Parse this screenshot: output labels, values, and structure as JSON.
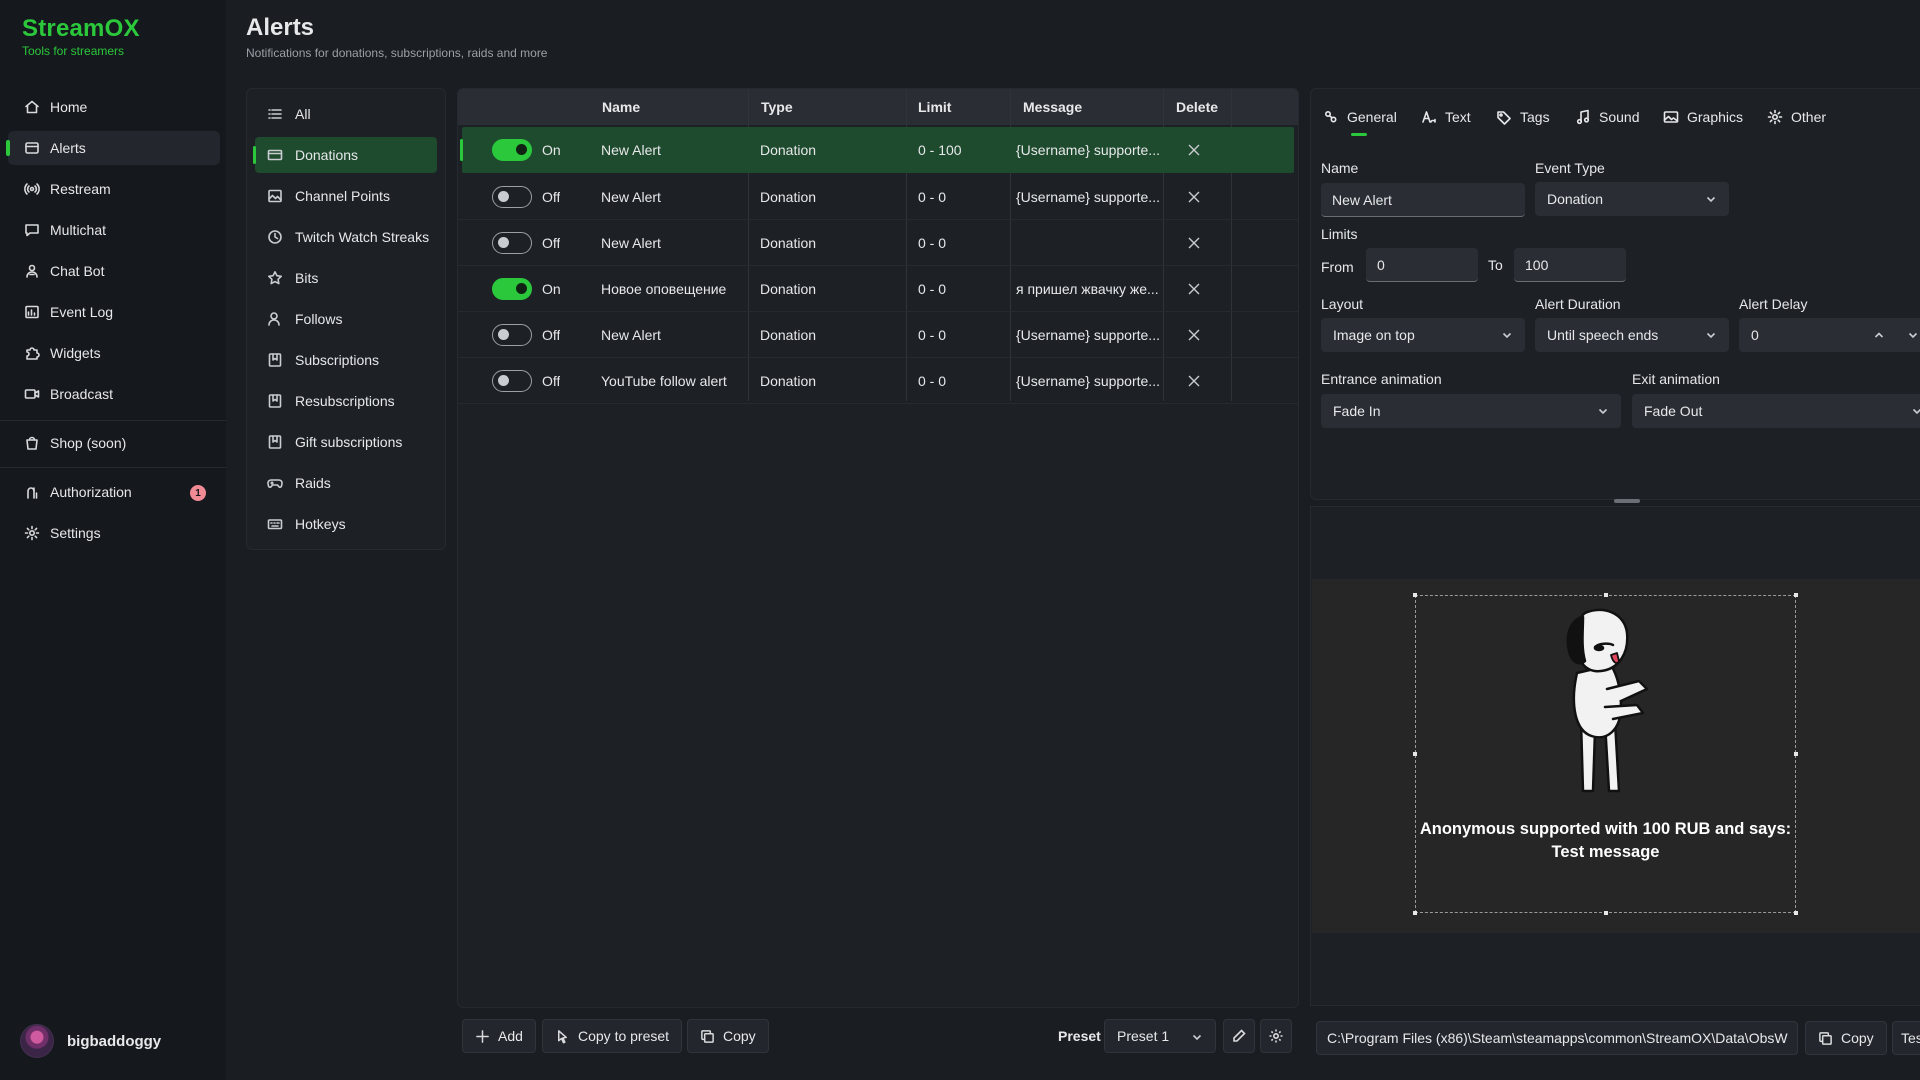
{
  "app": {
    "name": "StreamOX",
    "tagline": "Tools for streamers"
  },
  "nav": {
    "items": [
      {
        "label": "Home",
        "icon": "home-icon"
      },
      {
        "label": "Alerts",
        "icon": "alerts-icon",
        "active": true
      },
      {
        "label": "Restream",
        "icon": "broadcast-waves-icon"
      },
      {
        "label": "Multichat",
        "icon": "chat-icon"
      },
      {
        "label": "Chat Bot",
        "icon": "bot-icon"
      },
      {
        "label": "Event Log",
        "icon": "chart-icon"
      },
      {
        "label": "Widgets",
        "icon": "puzzle-icon"
      },
      {
        "label": "Broadcast",
        "icon": "video-icon"
      },
      {
        "label": "Shop (soon)",
        "icon": "shopping-bag-icon"
      },
      {
        "label": "Authorization",
        "icon": "key-icon",
        "badge": "1"
      },
      {
        "label": "Settings",
        "icon": "gear-icon"
      }
    ]
  },
  "user": {
    "name": "bigbaddoggy"
  },
  "header": {
    "title": "Alerts",
    "subtitle": "Notifications for donations, subscriptions, raids and more"
  },
  "categories": [
    {
      "label": "All",
      "icon": "list-icon"
    },
    {
      "label": "Donations",
      "icon": "card-icon",
      "active": true
    },
    {
      "label": "Channel Points",
      "icon": "image-icon"
    },
    {
      "label": "Twitch Watch Streaks",
      "icon": "clock-icon"
    },
    {
      "label": "Bits",
      "icon": "star-icon"
    },
    {
      "label": "Follows",
      "icon": "person-icon"
    },
    {
      "label": "Subscriptions",
      "icon": "bookmark-icon"
    },
    {
      "label": "Resubscriptions",
      "icon": "bookmark-icon"
    },
    {
      "label": "Gift subscriptions",
      "icon": "bookmark-icon"
    },
    {
      "label": "Raids",
      "icon": "gamepad-icon"
    },
    {
      "label": "Hotkeys",
      "icon": "keyboard-icon"
    }
  ],
  "table": {
    "columns": {
      "name": "Name",
      "type": "Type",
      "limit": "Limit",
      "message": "Message",
      "delete": "Delete"
    },
    "rows": [
      {
        "state": "On",
        "on": true,
        "name": "New Alert",
        "type": "Donation",
        "limit": "0 - 100",
        "message": "{Username} supporte...",
        "selected": true
      },
      {
        "state": "Off",
        "on": false,
        "name": "New Alert",
        "type": "Donation",
        "limit": "0 - 0",
        "message": "{Username} supporte..."
      },
      {
        "state": "Off",
        "on": false,
        "name": "New Alert",
        "type": "Donation",
        "limit": "0 - 0",
        "message": ""
      },
      {
        "state": "On",
        "on": true,
        "name": "Новое оповещение",
        "type": "Donation",
        "limit": "0 - 0",
        "message": "я пришел жвачку же..."
      },
      {
        "state": "Off",
        "on": false,
        "name": "New Alert",
        "type": "Donation",
        "limit": "0 - 0",
        "message": "{Username} supporte..."
      },
      {
        "state": "Off",
        "on": false,
        "name": "YouTube follow alert",
        "type": "Donation",
        "limit": "0 - 0",
        "message": "{Username} supporte..."
      }
    ]
  },
  "toolbar": {
    "add": "Add",
    "copy_to_preset": "Copy to preset",
    "copy": "Copy",
    "preset_label": "Preset",
    "preset_value": "Preset 1"
  },
  "settings": {
    "tabs": [
      {
        "label": "General",
        "icon": "sliders-icon",
        "active": true
      },
      {
        "label": "Text",
        "icon": "text-icon"
      },
      {
        "label": "Tags",
        "icon": "tag-icon"
      },
      {
        "label": "Sound",
        "icon": "music-icon"
      },
      {
        "label": "Graphics",
        "icon": "image-icon"
      },
      {
        "label": "Other",
        "icon": "gear-icon"
      }
    ],
    "name_label": "Name",
    "name_value": "New Alert",
    "event_type_label": "Event Type",
    "event_type_value": "Donation",
    "limits_label": "Limits",
    "from_label": "From",
    "from_value": "0",
    "to_label": "To",
    "to_value": "100",
    "layout_label": "Layout",
    "layout_value": "Image on top",
    "duration_label": "Alert Duration",
    "duration_value": "Until speech ends",
    "delay_label": "Alert Delay",
    "delay_value": "0",
    "entrance_label": "Entrance animation",
    "entrance_value": "Fade In",
    "exit_label": "Exit animation",
    "exit_value": "Fade Out"
  },
  "preview": {
    "text": "Anonymous supported with 100 RUB and says: Test message"
  },
  "pathbar": {
    "path": "C:\\Program Files (x86)\\Steam\\steamapps\\common\\StreamOX\\Data\\ObsW",
    "copy": "Copy",
    "test": "Tes"
  },
  "colors": {
    "accent": "#2bc83c",
    "selected_row": "#1e4a2d",
    "badge": "#f08a95",
    "background": "#1a1d22"
  }
}
